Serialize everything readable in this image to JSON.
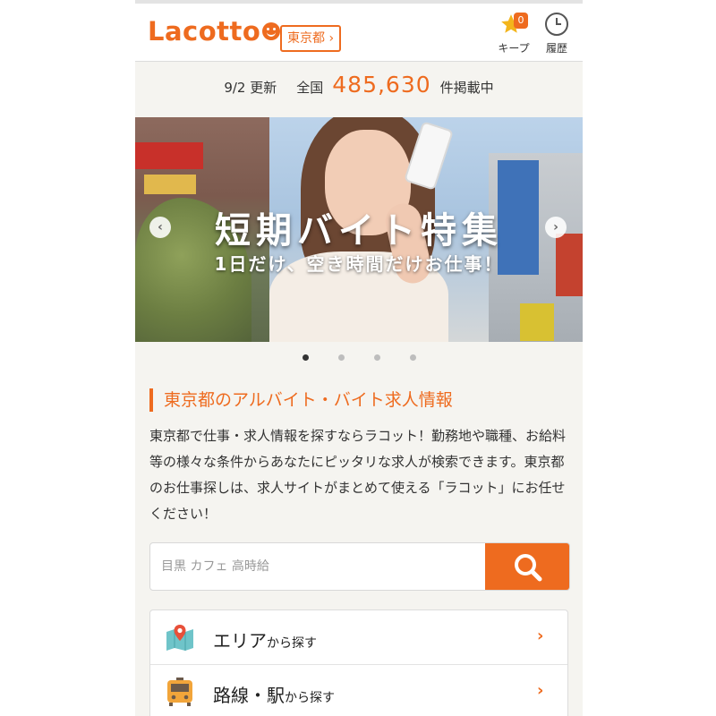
{
  "header": {
    "logo_text": "Lacotto",
    "region_button": "東京都 ›",
    "keep_label": "キープ",
    "keep_count": "0",
    "history_label": "履歴"
  },
  "stats": {
    "updated": "9/2 更新",
    "nationwide": "全国",
    "count": "485,630",
    "suffix": "件掲載中"
  },
  "banner": {
    "title": "短期バイト特集",
    "subtitle": "1日だけ、空き時間だけお仕事！",
    "prev_arrow": "‹",
    "next_arrow": "›",
    "slide_count": 4,
    "active_slide": 1
  },
  "intro": {
    "title": "東京都のアルバイト・バイト求人情報",
    "description": "東京都で仕事・求人情報を探すならラコット！勤務地や職種、お給料等の様々な条件からあなたにピッタリな求人が検索できます。東京都のお仕事探しは、求人サイトがまとめて使える「ラコット」にお任せください！"
  },
  "search": {
    "placeholder": "目黒 カフェ 高時給",
    "value": ""
  },
  "menu": {
    "items": [
      {
        "label_main": "エリア",
        "label_suffix": "から探す",
        "icon": "map-icon",
        "chevron": "›"
      },
      {
        "label_main": "路線・駅",
        "label_suffix": "から探す",
        "icon": "train-icon",
        "chevron": "›"
      }
    ]
  },
  "colors": {
    "accent": "#ee6b1f",
    "background": "#f5f4f0",
    "text": "#333333"
  }
}
